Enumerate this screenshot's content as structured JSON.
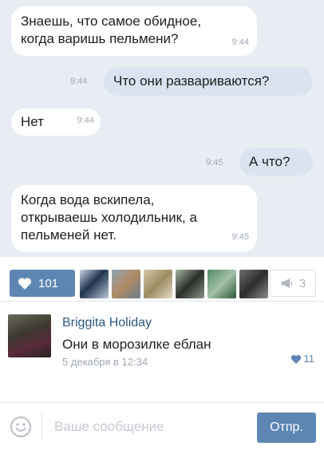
{
  "messages": [
    {
      "text": "Знаешь, что самое обидное,\nкогда варишь пельмени?",
      "time": "9:44"
    },
    {
      "text": "Что они развариваются?",
      "time": "9:44"
    },
    {
      "text": "Нет",
      "time": "9:44"
    },
    {
      "text": "А что?",
      "time": "9:45"
    },
    {
      "text": "Когда вода вскипела,\nоткрываешь холодильник, а\nпельменей нет.",
      "time": "9:45"
    }
  ],
  "actions": {
    "like_count": "101",
    "share_count": "3"
  },
  "comment": {
    "author": "Briggita Holiday",
    "text": "Они в морозилке еблан",
    "date": "5 декабря в 12:34",
    "likes": "11"
  },
  "composer": {
    "placeholder": "Ваше сообщение",
    "send_label": "Отпр."
  },
  "colors": {
    "accent": "#5d86b3",
    "chat_bg": "#e8edf3",
    "incoming": "#ffffff",
    "outgoing": "#d9e4f0"
  }
}
